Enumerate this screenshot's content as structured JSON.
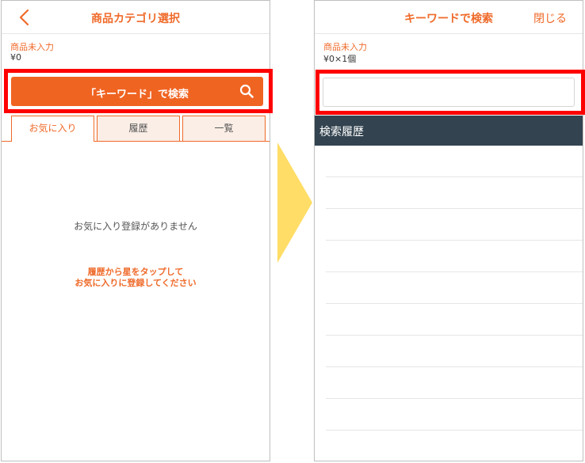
{
  "left_screen": {
    "title": "商品カテゴリ選択",
    "back_icon": "chevron-left-icon",
    "product_label": "商品未入力",
    "product_price": "¥0",
    "search_button_label": "「キーワード」で検索",
    "search_icon": "search-icon",
    "tabs": [
      {
        "label": "お気に入り",
        "active": true
      },
      {
        "label": "履歴",
        "active": false
      },
      {
        "label": "一覧",
        "active": false
      }
    ],
    "empty_message": "お気に入り登録がありません",
    "hint_line1": "履歴から星をタップして",
    "hint_line2": "お気に入りに登録してください"
  },
  "right_screen": {
    "title": "キーワードで検索",
    "close_label": "閉じる",
    "product_label": "商品未入力",
    "product_price": "¥0×1個",
    "search_input_value": "",
    "history_header": "検索履歴",
    "history_rows": [
      "",
      "",
      "",
      "",
      "",
      "",
      "",
      "",
      "",
      ""
    ]
  },
  "colors": {
    "accent": "#ef6a2a",
    "highlight_box": "#ff0000",
    "transition_arrow": "#ffdd66",
    "history_header_bg": "#334450"
  }
}
